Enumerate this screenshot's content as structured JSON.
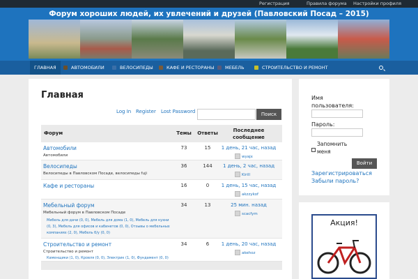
{
  "topbar": {
    "register": "Регистрация",
    "rules": "Правила форума",
    "profile": "Настройки профиля"
  },
  "site_title": "Форум хороших людей, их увлечений и друзей (Павловский Посад – 2015)",
  "nav": [
    {
      "label": "ГЛАВНАЯ",
      "active": true
    },
    {
      "label": "АВТОМОБИЛИ",
      "icon": "car-icon",
      "color": "#6b4f2a"
    },
    {
      "label": "ВЕЛОСИПЕДЫ",
      "icon": "bicycle-icon",
      "color": "#3a6fa8"
    },
    {
      "label": "КАФЕ И РЕСТОРАНЫ",
      "icon": "cafe-icon",
      "color": "#7a5b3a"
    },
    {
      "label": "МЕБЕЛЬ",
      "icon": "furniture-icon",
      "color": "#5a5a7a"
    },
    {
      "label": "СТРОИТЕЛЬСТВО И РЕМОНТ",
      "icon": "construction-icon",
      "color": "#c8c02a"
    }
  ],
  "page_title": "Главная",
  "links": {
    "login": "Log In",
    "register": "Register",
    "lost": "Lost Password",
    "search": "Поиск"
  },
  "table": {
    "headers": {
      "forum": "Форум",
      "topics": "Темы",
      "replies": "Ответы",
      "last": "Последнее сообщение"
    },
    "rows": [
      {
        "name": "Автомобили",
        "desc": "Автомобили",
        "topics": "73",
        "replies": "15",
        "last": "1 день, 21 час, назад",
        "user": "wyajx",
        "subs": []
      },
      {
        "name": "Велосипеды",
        "desc": "Велосипеды в Павловском Посаде, велосипеды fuji",
        "topics": "36",
        "replies": "144",
        "last": "1 день, 2 час, назад",
        "user": "Kirill",
        "subs": []
      },
      {
        "name": "Кафе и рестораны",
        "desc": "",
        "topics": "16",
        "replies": "0",
        "last": "1 день, 15 час, назад",
        "user": "akzzykof",
        "subs": []
      },
      {
        "name": "Мебельный форум",
        "desc": "Мебельный форум в Павловском Посаде",
        "topics": "34",
        "replies": "13",
        "last": "25 мин. назад",
        "user": "scacfym",
        "subs": [
          "Мебель для дачи (0, 0), Мебель для дома (1, 0), Мебель для кухни",
          "(0, 3), Мебель для офисов и кабинетов (0, 0), Отзывы о мебельных",
          "компаниях (2, 0), Мебель б/у (0, 0)"
        ]
      },
      {
        "name": "Строительство и ремонт",
        "desc": "Строительство и ремонт",
        "topics": "34",
        "replies": "6",
        "last": "1 день, 20 час, назад",
        "user": "akehoz",
        "subs": [
          "Каменщики (1, 0), Кровля (0, 0), Электрик (1, 0), Фундамент (0, 0)"
        ]
      }
    ]
  },
  "login": {
    "username": "Имя пользователя:",
    "password": "Пароль:",
    "remember": "Запомнить меня",
    "button": "Войти",
    "register": "Зарегистрироваться",
    "forgot": "Забыли пароль?"
  },
  "ad": {
    "title": "Акция!"
  }
}
